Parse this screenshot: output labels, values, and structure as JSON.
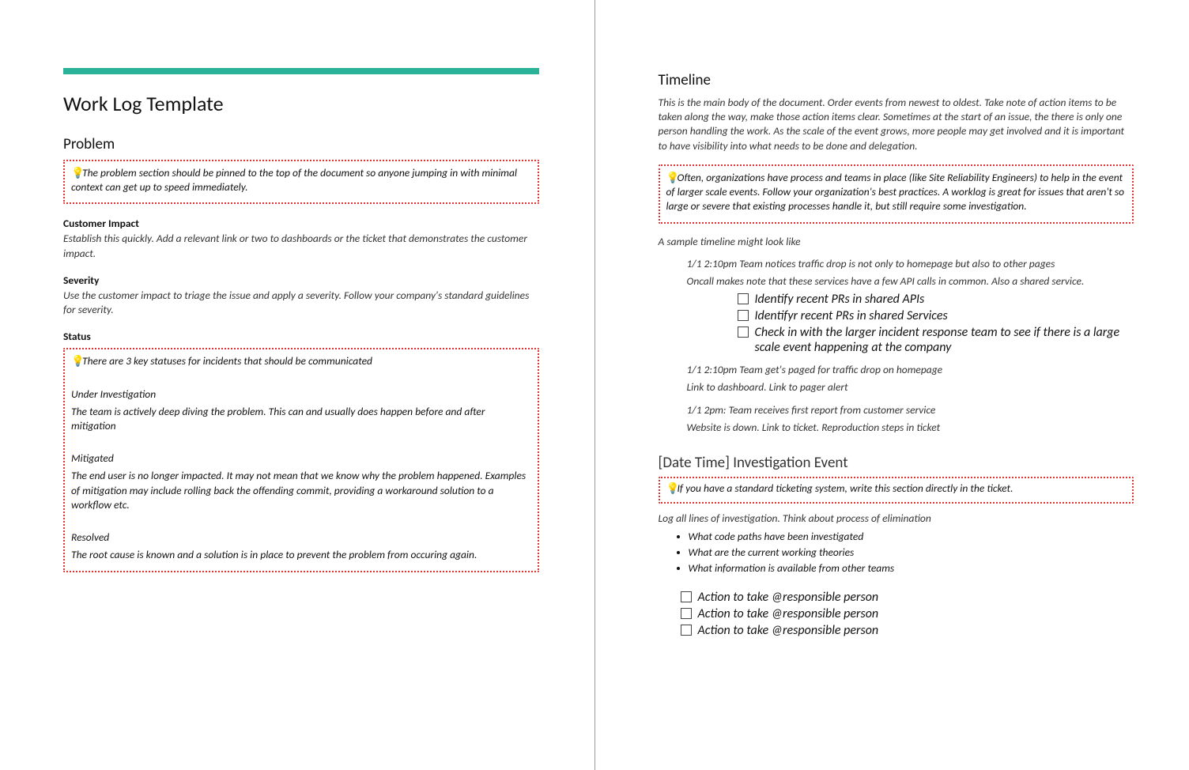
{
  "left": {
    "title": "Work Log Template",
    "problem_h": "Problem",
    "problem_tip": "The problem section should  be pinned to the top of the document so anyone jumping in with minimal context can get up to speed immediately.",
    "ci_h": "Customer Impact",
    "ci_p": "Establish this quickly. Add a relevant link or two to dashboards or the ticket that demonstrates the customer impact.",
    "sev_h": "Severity",
    "sev_p": "Use the customer impact to triage the issue and apply a severity. Follow your company's standard guidelines for severity.",
    "status_h": "Status",
    "status_tip": "There are 3 key statuses for incidents that should be communicated",
    "s1_h": "Under Investigation",
    "s1_p": "The team is actively deep diving the problem. This can and usually does happen before and after mitigation",
    "s2_h": "Mitigated",
    "s2_p": "The end user is no longer impacted. It may not mean that we know why the problem happened. Examples of mitigation may include rolling back the offending commit, providing a workaround solution to a workflow etc.",
    "s3_h": "Resolved",
    "s3_p": "The root cause is known and a solution is in place to prevent the problem from occuring again."
  },
  "right": {
    "tl_h": "Timeline",
    "tl_p": "This is the main body of the document. Order events from newest to oldest. Take note of action items to be taken along the way, make those action items clear. Sometimes at the start of an issue, the there is only one person handling the work. As the scale of the event grows, more people may get involved and it is important to have visibility into what needs to be done and delegation.",
    "tl_tip": "Often, organizations have process and teams in place (like Site Reliability Engineers) to help in the event of larger scale events. Follow your organization's best practices. A worklog is great for issues that aren't so large or severe that existing processes handle it, but still require some investigation.",
    "sample_lead": "A sample timeline might look like",
    "e1a": "1/1 2:10pm Team notices traffic drop is not only to homepage but also to other pages",
    "e1b": "Oncall makes note that these services have a few API calls in common. Also a shared service.",
    "e1_c1": "Identify  recent PRs in shared APIs",
    "e1_c2": "Identifyr recent PRs in shared Services",
    "e1_c3": "Check in with the larger incident response team to see if there is a large scale event happening at the company",
    "e2a": "1/1 2:10pm Team get's paged for traffic drop on homepage",
    "e2b": "Link to dashboard. Link to pager alert",
    "e3a": "1/1 2pm: Team receives first report from customer service",
    "e3b": "Website is down. Link to ticket. Reproduction steps in ticket",
    "inv_h": "[Date Time] Investigation Event",
    "inv_tip": "If you have a standard ticketing system, write this section directly in the ticket.",
    "inv_lead": "Log all lines of investigation. Think about process of elimination",
    "inv_b1": "What code paths have been investigated",
    "inv_b2": "What are the current working theories",
    "inv_b3": "What information is available from other teams",
    "act1": "Action to take @responsible person",
    "act2": "Action to take @responsible person",
    "act3": "Action to take @responsible person"
  }
}
